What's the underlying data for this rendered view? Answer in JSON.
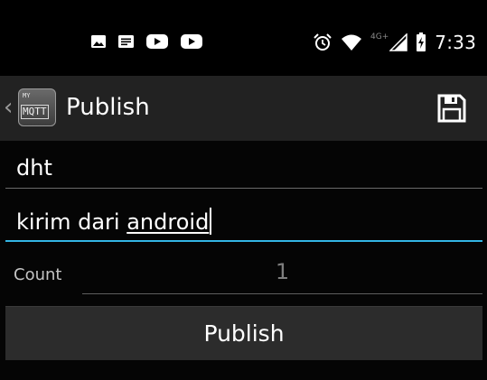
{
  "status_bar": {
    "notification_icons": [
      "image-icon",
      "message-icon",
      "youtube-icon",
      "youtube-icon"
    ],
    "system_icons": [
      "alarm-icon",
      "wifi-icon",
      "cell-signal-icon",
      "battery-charging-icon"
    ],
    "network_type": "4G+",
    "time": "7:33"
  },
  "action_bar": {
    "up_icon": "chevron-left-icon",
    "logo_text_small": "MY",
    "logo_text_big": "MQTT",
    "title": "Publish",
    "save_icon": "save-icon"
  },
  "form": {
    "topic_value": "dht",
    "message_prefix": "kirim dari ",
    "message_underlined": "android",
    "count_label": "Count",
    "count_value": "1",
    "publish_label": "Publish"
  },
  "colors": {
    "focus_accent": "#33b5e5",
    "action_bar_bg": "#222222",
    "button_bg": "#2c2c2c"
  }
}
